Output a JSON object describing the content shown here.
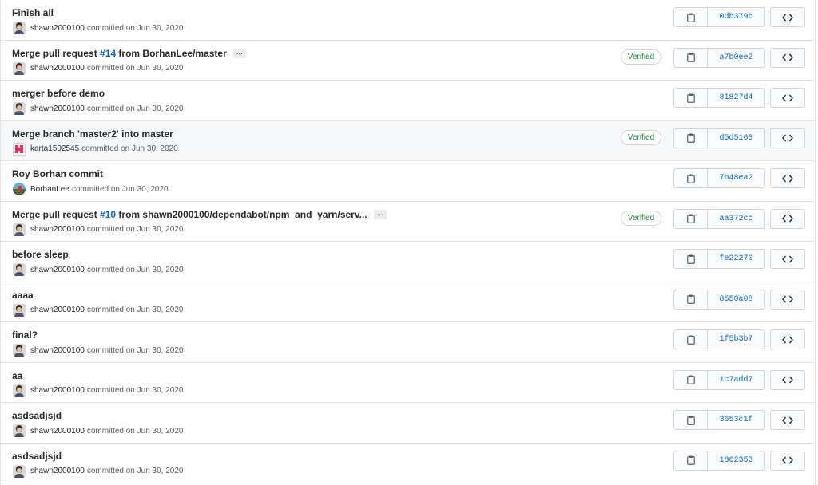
{
  "commits": [
    {
      "title": "Finish all",
      "author": "shawn2000100",
      "committed": "committed on Jun 30, 2020",
      "sha": "0db379b",
      "avatar": "shawn-avatar"
    },
    {
      "title_prefix": "Merge pull request ",
      "pr": "#14",
      "title_suffix": " from BorhanLee/master",
      "has_ellipsis": true,
      "ellipsis": "…",
      "verified": "Verified",
      "author": "shawn2000100",
      "committed": "committed on Jun 30, 2020",
      "sha": "a7b0ee2",
      "avatar": "shawn-avatar"
    },
    {
      "title": "merger before demo",
      "author": "shawn2000100",
      "committed": "committed on Jun 30, 2020",
      "sha": "81827d4",
      "avatar": "shawn-avatar"
    },
    {
      "title": "Merge branch 'master2' into master",
      "verified": "Verified",
      "author": "karta1502545",
      "committed": "committed on Jun 30, 2020",
      "sha": "d5d5163",
      "avatar": "karta-avatar",
      "hover": true
    },
    {
      "title": "Roy Borhan commit",
      "author": "BorhanLee",
      "committed": "committed on Jun 30, 2020",
      "sha": "7b48ea2",
      "avatar": "borhan-avatar"
    },
    {
      "title_prefix": "Merge pull request ",
      "pr": "#10",
      "title_suffix": " from shawn2000100/dependabot/npm_and_yarn/serv...",
      "has_ellipsis": true,
      "ellipsis": "…",
      "verified": "Verified",
      "author": "shawn2000100",
      "committed": "committed on Jun 30, 2020",
      "sha": "aa372cc",
      "avatar": "shawn-avatar"
    },
    {
      "title": "before sleep",
      "author": "shawn2000100",
      "committed": "committed on Jun 30, 2020",
      "sha": "fe22270",
      "avatar": "shawn-avatar"
    },
    {
      "title": "aaaa",
      "author": "shawn2000100",
      "committed": "committed on Jun 30, 2020",
      "sha": "8550a08",
      "avatar": "shawn-avatar"
    },
    {
      "title": "final?",
      "author": "shawn2000100",
      "committed": "committed on Jun 30, 2020",
      "sha": "1f5b3b7",
      "avatar": "shawn-avatar"
    },
    {
      "title": "aa",
      "author": "shawn2000100",
      "committed": "committed on Jun 30, 2020",
      "sha": "1c7add7",
      "avatar": "shawn-avatar"
    },
    {
      "title": "asdsadjsjd",
      "author": "shawn2000100",
      "committed": "committed on Jun 30, 2020",
      "sha": "3653c1f",
      "avatar": "shawn-avatar"
    },
    {
      "title": "asdsadjsjd",
      "author": "shawn2000100",
      "committed": "committed on Jun 30, 2020",
      "sha": "1862353",
      "avatar": "shawn-avatar"
    }
  ],
  "icons": {
    "copy": "clipboard-icon",
    "browse": "code-icon"
  },
  "colors": {
    "link": "#0366d6",
    "verified": "#22863a",
    "border": "#e1e4e8",
    "hover_bg": "#f6f8fa"
  }
}
